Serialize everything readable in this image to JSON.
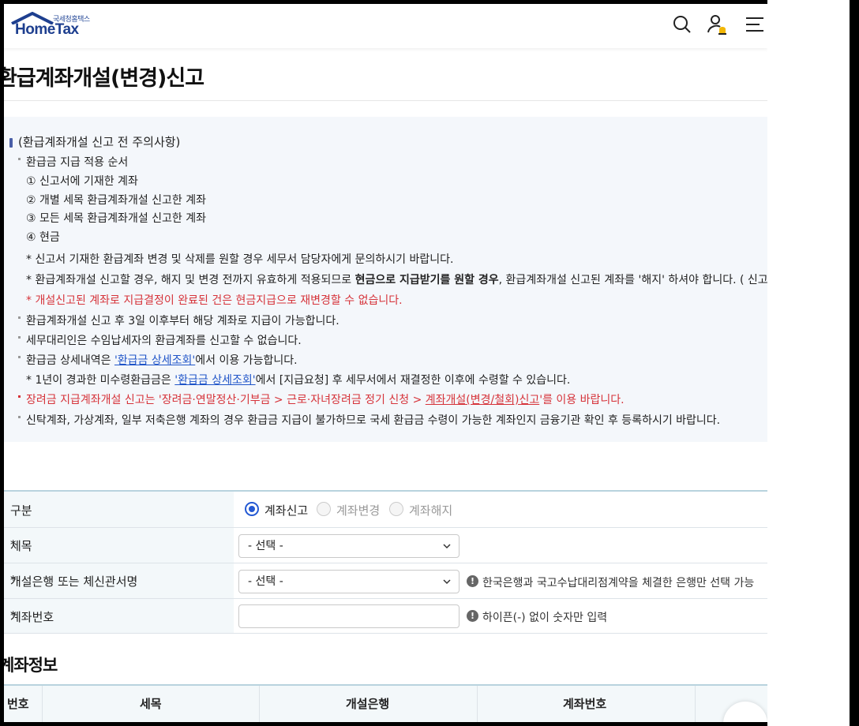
{
  "header": {
    "logo_sub": "국세청홈택스",
    "logo_brand": "HomeTax",
    "icons": [
      "search-icon",
      "user-bell-icon",
      "menu-icon"
    ]
  },
  "page_title": "환급계좌개설(변경)신고",
  "notice": {
    "heading": "(환급계좌개설 신고 전 주의사항)",
    "order_title": "환급금 지급 적용 순서",
    "order": [
      "① 신고서에 기재한 계좌",
      "② 개별 세목 환급계좌개설 신고한 계좌",
      "③ 모든 세목 환급계좌개설 신고한 계좌",
      "④ 현금"
    ],
    "star1": "* 신고서 기재한 환급계좌 변경 및 삭제를 원할 경우 세무서 담당자에게 문의하시기 바랍니다.",
    "star2_a": "* 환급계좌개설 신고할 경우, 해지 및 변경 전까지 유효하게 적용되므로 ",
    "star2_b": "현금으로 지급받기를 원할 경우",
    "star2_c": ", 환급계좌개설 신고된 계좌를 '해지' 하셔야 합니다. ( 신고",
    "star3": "* 개설신고된 계좌로 지급결정이 완료된 건은 현금지급으로 재변경할 수 없습니다.",
    "b1": "환급계좌개설 신고 후 3일 이후부터 해당 계좌로 지급이 가능합니다.",
    "b2": "세무대리인은 수임납세자의 환급계좌를 신고할 수 없습니다.",
    "b3_a": "환급금 상세내역은 ",
    "b3_link": "'환급금 상세조회'",
    "b3_b": "에서 이용 가능합니다.",
    "b3_sub_a": "* 1년이 경과한 미수령환급금은 ",
    "b3_sub_link": "'환급금 상세조회'",
    "b3_sub_b": "에서 [지급요청] 후 세무서에서 재결정한 이후에 수령할 수 있습니다.",
    "b4_a": "장려금 지급계좌개설 신고는 '장려금·연말정산·기부금 > 근로·자녀장려금 정기 신청 > ",
    "b4_link": "계좌개설(변경/철회)신고",
    "b4_b": "'를 이용 바랍니다.",
    "b5": "신탁계좌, 가상계좌, 일부 저축은행 계좌의 경우 환급금 지급이 불가하므로 국세 환급금 수령이 가능한 계좌인지 금융기관 확인 후 등록하시기 바랍니다."
  },
  "form": {
    "row1_label": "구분",
    "radios": [
      "계좌신고",
      "계좌변경",
      "계좌해지"
    ],
    "row2_label": "세목",
    "row2_select": "- 선택 -",
    "row3_label": "개설은행 또는 체신관서명",
    "row3_select": "- 선택 -",
    "row3_info": "한국은행과 국고수납대리점계약을 체결한 은행만 선택 가능",
    "row4_label": "계좌번호",
    "row4_value": "",
    "row4_info": "하이픈(-) 없이 숫자만 입력",
    "required_mark": "*",
    "info_mark": "!"
  },
  "section2_title": "계좌정보",
  "table_headers": [
    "번호",
    "세목",
    "개설은행",
    "계좌번호"
  ]
}
